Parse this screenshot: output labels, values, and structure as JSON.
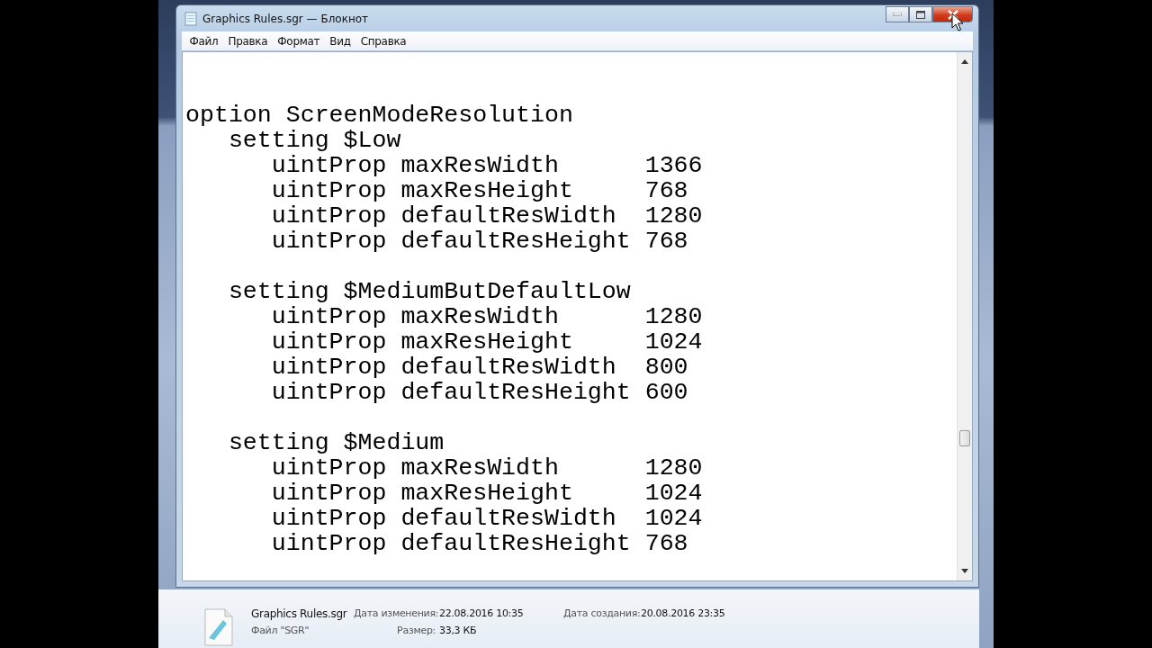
{
  "window": {
    "title": "Graphics Rules.sgr — Блокнот"
  },
  "menu": [
    "Файл",
    "Правка",
    "Формат",
    "Вид",
    "Справка"
  ],
  "document": {
    "option": "option ScreenModeResolution",
    "settings": [
      {
        "name": "setting $Low",
        "props": [
          {
            "name": "uintProp maxResWidth",
            "value": "1366"
          },
          {
            "name": "uintProp maxResHeight",
            "value": "768"
          },
          {
            "name": "uintProp defaultResWidth",
            "value": "1280"
          },
          {
            "name": "uintProp defaultResHeight",
            "value": "768"
          }
        ]
      },
      {
        "name": "setting $MediumButDefaultLow",
        "props": [
          {
            "name": "uintProp maxResWidth",
            "value": "1280"
          },
          {
            "name": "uintProp maxResHeight",
            "value": "1024"
          },
          {
            "name": "uintProp defaultResWidth",
            "value": "800"
          },
          {
            "name": "uintProp defaultResHeight",
            "value": "600"
          }
        ]
      },
      {
        "name": "setting $Medium",
        "props": [
          {
            "name": "uintProp maxResWidth",
            "value": "1280"
          },
          {
            "name": "uintProp maxResHeight",
            "value": "1024"
          },
          {
            "name": "uintProp defaultResWidth",
            "value": "1024"
          },
          {
            "name": "uintProp defaultResHeight",
            "value": "768"
          }
        ]
      }
    ]
  },
  "details": {
    "file_name": "Graphics Rules.sgr",
    "file_type": "Файл \"SGR\"",
    "fields": [
      {
        "label": "Дата изменения:",
        "value": "22.08.2016 10:35"
      },
      {
        "label": "Размер:",
        "value": "33,3 КБ"
      },
      {
        "label": "Дата создания:",
        "value": "20.08.2016 23:35"
      }
    ]
  }
}
